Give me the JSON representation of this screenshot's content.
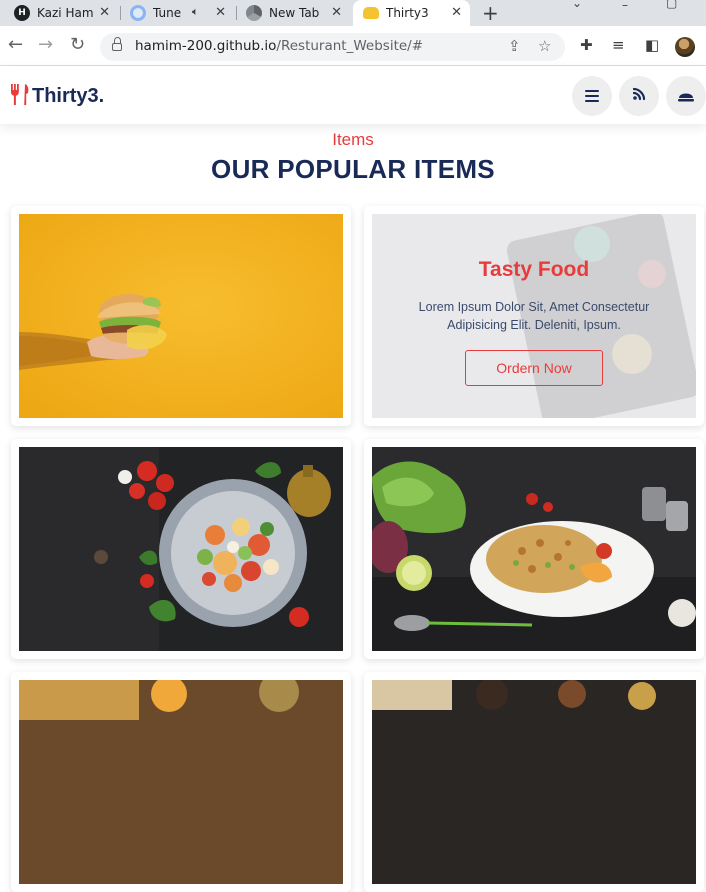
{
  "browser": {
    "tabs": [
      {
        "title": "Kazi Ham",
        "icon": "h-logo-icon"
      },
      {
        "title": "Tune",
        "icon": "tune-icon"
      },
      {
        "title": "New Tab",
        "icon": "chrome-icon"
      },
      {
        "title": "Thirty3",
        "icon": "burger-favicon-icon"
      }
    ],
    "url_host": "hamim-200.github.io",
    "url_path": "/Resturant_Website/#"
  },
  "site": {
    "logo_text": "Thirty3.",
    "brand_color": "#e83c3c",
    "heading_color": "#192a56",
    "sub_heading": "Items",
    "main_heading": "OUR POPULAR ITEMS",
    "promo": {
      "title": "Tasty Food",
      "description": "Lorem Ipsum Dolor Sit, Amet Consectetur Adipisicing Elit. Deleniti, Ipsum.",
      "button_label": "Ordern Now"
    }
  }
}
